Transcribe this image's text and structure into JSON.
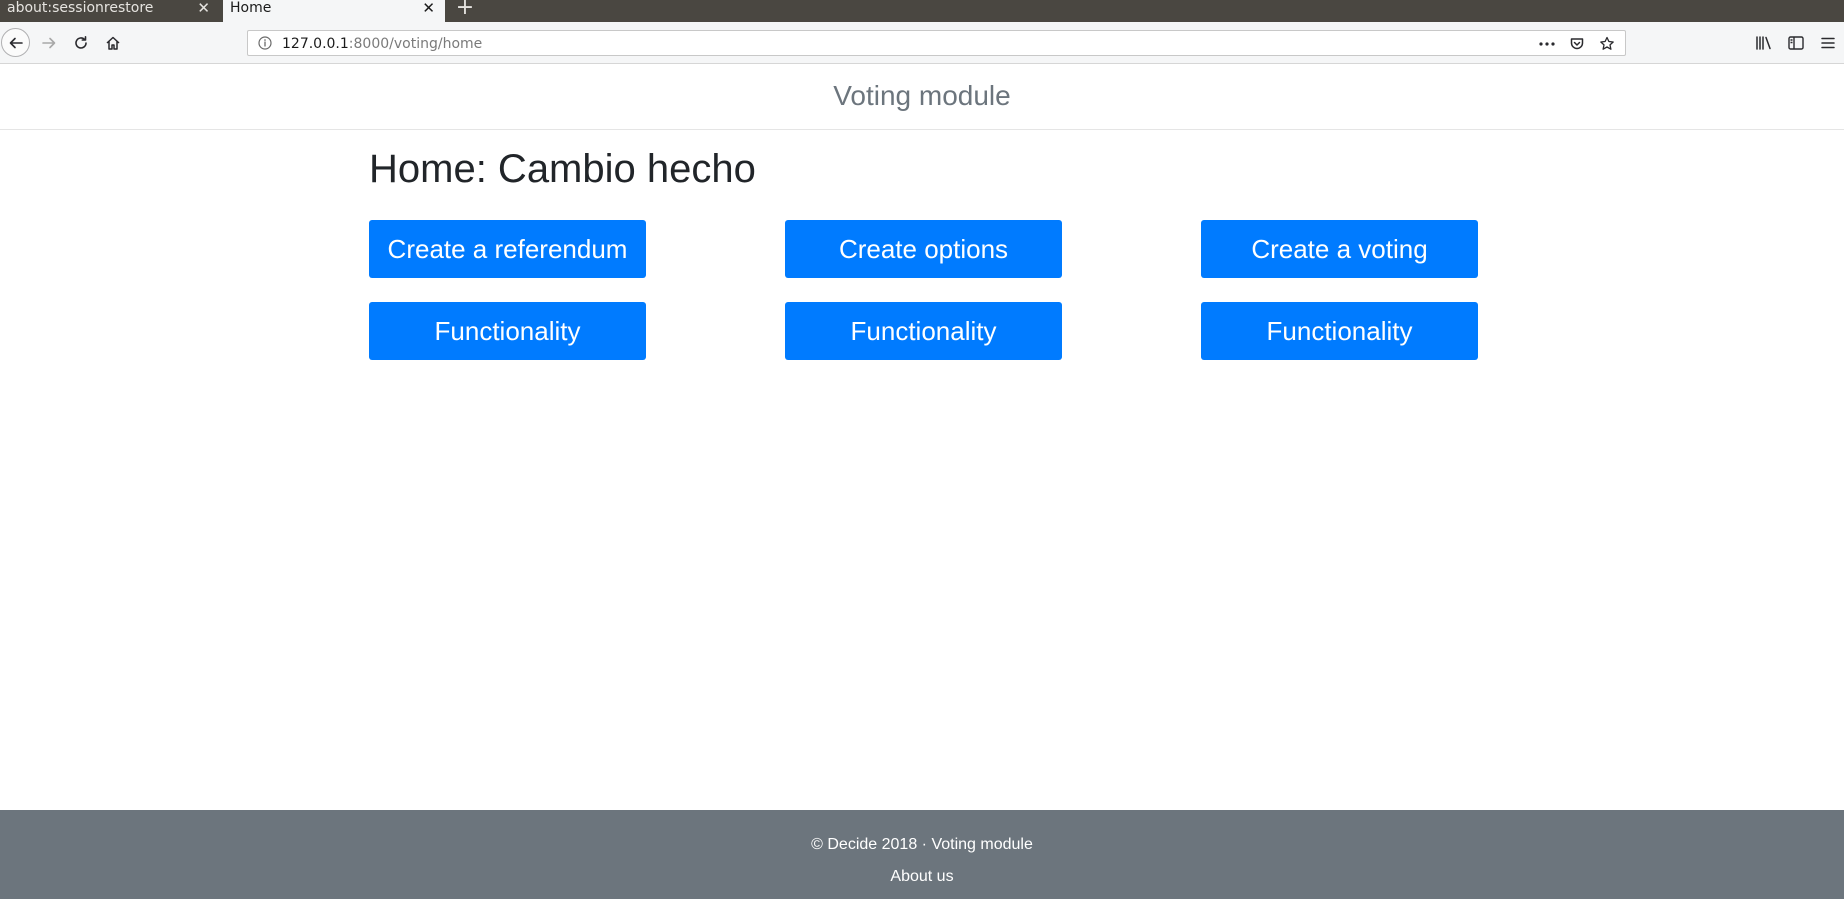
{
  "browser": {
    "tabs": [
      {
        "title": "about:sessionrestore",
        "active": false
      },
      {
        "title": "Home",
        "active": true
      }
    ],
    "close_glyph": "✕",
    "new_tab_glyph": "+",
    "url": {
      "host": "127.0.0.1",
      "path": ":8000/voting/home"
    }
  },
  "header": {
    "brand": "Voting module"
  },
  "main": {
    "heading": "Home: Cambio hecho",
    "buttons": {
      "row1": [
        "Create a referendum",
        "Create options",
        "Create a voting"
      ],
      "row2": [
        "Functionality",
        "Functionality",
        "Functionality"
      ]
    }
  },
  "footer": {
    "copyright": "© Decide 2018 · Voting module",
    "about_link": "About us"
  },
  "colors": {
    "primary_button": "#007bff",
    "footer_bg": "#6c757d",
    "tabbar_bg": "#4a4741"
  },
  "icons": [
    "back-arrow-icon",
    "forward-arrow-icon",
    "reload-icon",
    "home-icon",
    "info-icon",
    "more-dots-icon",
    "pocket-icon",
    "bookmark-star-icon",
    "library-icon",
    "sidebar-icon",
    "menu-icon"
  ]
}
